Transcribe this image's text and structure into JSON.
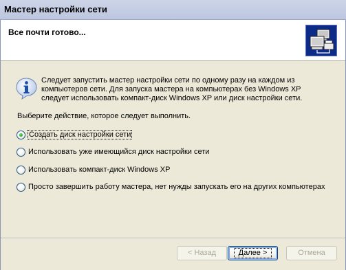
{
  "window": {
    "title": "Мастер настройки сети"
  },
  "header": {
    "heading": "Все почти готово...",
    "icon": "network-computers-icon"
  },
  "info": {
    "icon": "info-icon",
    "lines": [
      "Следует запустить мастер настройки сети по одному разу на каждом из",
      "компьютеров сети. Для запуска мастера на компьютерах без Windows XP",
      "следует использовать компакт-диск Windows XP или диск настройки сети."
    ]
  },
  "prompt": "Выберите действие, которое следует выполнить.",
  "options": [
    {
      "label": "Создать диск настройки сети",
      "checked": true
    },
    {
      "label": "Использовать уже имеющийся диск настройки сети",
      "checked": false
    },
    {
      "label": "Использовать компакт-диск Windows XP",
      "checked": false
    },
    {
      "label": "Просто завершить работу мастера, нет нужды запускать его на других компьютерах",
      "checked": false
    }
  ],
  "buttons": {
    "back": "< Назад",
    "next": "Далее >",
    "cancel": "Отмена"
  },
  "colors": {
    "dialog_bg": "#ece9d8",
    "header_bg": "#ffffff",
    "radio_check": "#21a121",
    "icon_bg": "#0c2a88"
  }
}
